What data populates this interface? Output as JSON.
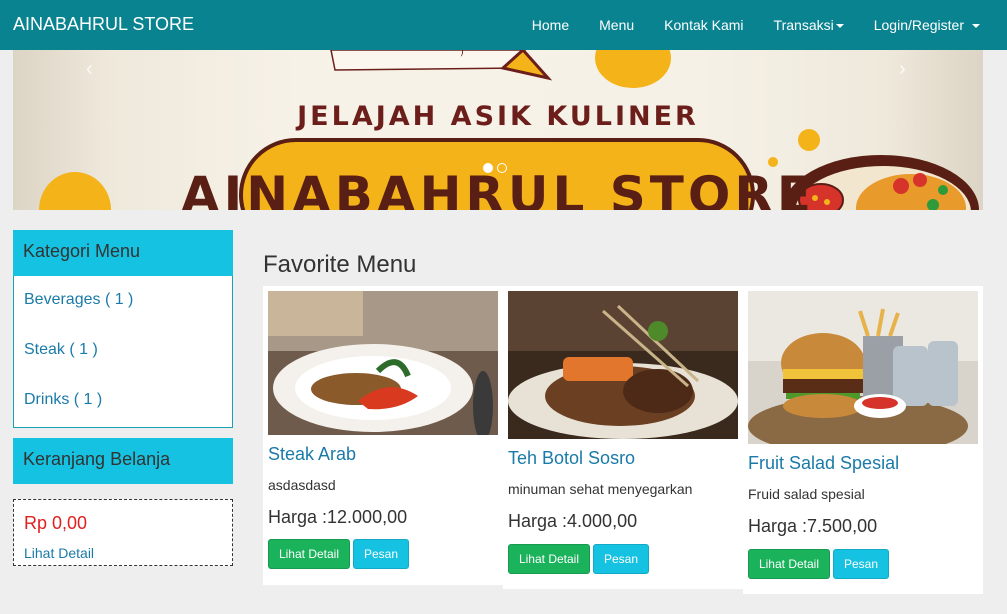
{
  "navbar": {
    "brand": "AINABAHRUL STORE",
    "items": [
      {
        "label": "Home"
      },
      {
        "label": "Menu"
      },
      {
        "label": "Kontak Kami"
      },
      {
        "label": "Transaksi"
      },
      {
        "label": "Login/Register"
      }
    ]
  },
  "banner": {
    "tagline": "JELAJAH ASIK KULINER",
    "title": "AINABAHRUL STORE",
    "prev_glyph": "‹",
    "next_glyph": "›",
    "slide_count": 2,
    "active_slide": 1
  },
  "sidebar": {
    "category_heading": "Kategori Menu",
    "categories": [
      {
        "label": "Beverages ( 1 )"
      },
      {
        "label": "Steak ( 1 )"
      },
      {
        "label": "Drinks ( 1 )"
      }
    ],
    "cart_heading": "Keranjang Belanja",
    "cart_total": "Rp 0,00",
    "cart_link": "Lihat Detail"
  },
  "main": {
    "section_title": "Favorite Menu",
    "products": [
      {
        "name": "Steak Arab",
        "description": "asdasdasd",
        "price": "Harga :12.000,00",
        "detail_label": "Lihat Detail",
        "order_label": "Pesan"
      },
      {
        "name": "Teh Botol Sosro",
        "description": "minuman sehat menyegarkan",
        "price": "Harga :4.000,00",
        "detail_label": "Lihat Detail",
        "order_label": "Pesan"
      },
      {
        "name": "Fruit Salad Spesial",
        "description": "Fruid salad spesial",
        "price": "Harga :7.500,00",
        "detail_label": "Lihat Detail",
        "order_label": "Pesan"
      }
    ]
  },
  "colors": {
    "navbar": "#0a8391",
    "panel_heading": "#16c2e1",
    "link": "#1a7aa8",
    "price_total": "#e02020",
    "button_success": "#1bb25c",
    "button_info": "#16c2e1"
  }
}
